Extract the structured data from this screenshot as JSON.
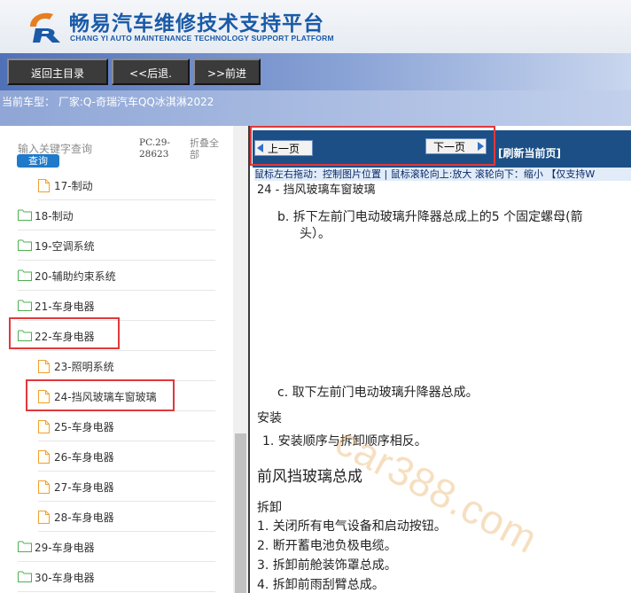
{
  "brand": {
    "title": "畅易汽车维修技术支持平台",
    "subtitle": "CHANG YI AUTO MAINTENANCE TECHNOLOGY SUPPORT PLATFORM"
  },
  "nav": {
    "home": "返回主目录",
    "back": "<<后退.",
    "forward": ">>前进"
  },
  "vehicle_info": "当前车型：  厂家:Q-奇瑞汽车QQ冰淇淋2022",
  "sidebar": {
    "search_placeholder": "输入关键字查询",
    "search_button": "查询",
    "pc_code": "PC.29-28623",
    "collapse_all": "折叠全部",
    "items": [
      {
        "label": "17-制动",
        "type": "file"
      },
      {
        "label": "18-制动",
        "type": "folder"
      },
      {
        "label": "19-空调系统",
        "type": "folder"
      },
      {
        "label": "20-辅助约束系统",
        "type": "folder"
      },
      {
        "label": "21-车身电器",
        "type": "folder"
      },
      {
        "label": "22-车身电器",
        "type": "folder"
      },
      {
        "label": "23-照明系统",
        "type": "file"
      },
      {
        "label": "24-挡风玻璃车窗玻璃",
        "type": "file"
      },
      {
        "label": "25-车身电器",
        "type": "file"
      },
      {
        "label": "26-车身电器",
        "type": "file"
      },
      {
        "label": "27-车身电器",
        "type": "file"
      },
      {
        "label": "28-车身电器",
        "type": "file"
      },
      {
        "label": "29-车身电器",
        "type": "folder"
      },
      {
        "label": "30-车身电器",
        "type": "folder"
      }
    ]
  },
  "viewer": {
    "prev_page": "上一页",
    "next_page": "下一页",
    "refresh": "[刷新当前页]",
    "hint": "鼠标左右拖动：控制图片位置 | 鼠标滚轮向上:放大  滚轮向下：缩小 【仅支持W"
  },
  "doc": {
    "section_header": "24 - 挡风玻璃车窗玻璃",
    "step_b": "b.  拆下左前门电动玻璃升降器总成上的5 个固定螺母(箭",
    "step_b_cont": "头）。",
    "step_c": "c.  取下左前门电动玻璃升降器总成。",
    "install_heading": "安装",
    "install_step1": "1.  安装顺序与拆卸顺序相反。",
    "title2": "前风挡玻璃总成",
    "remove_heading": "拆卸",
    "remove_steps": [
      "1.  关闭所有电气设备和启动按钮。",
      "2.  断开蓄电池负极电缆。",
      "3.  拆卸前舱装饰罩总成。",
      "4.  拆卸前雨刮臂总成。"
    ]
  },
  "watermark": "car388.com",
  "colors": {
    "brand_blue": "#1a5aa8",
    "toolbar_dark": "#1c4f86",
    "highlight_red": "#e0393b",
    "folder_green": "#4caf50",
    "file_orange": "#f0a030"
  }
}
